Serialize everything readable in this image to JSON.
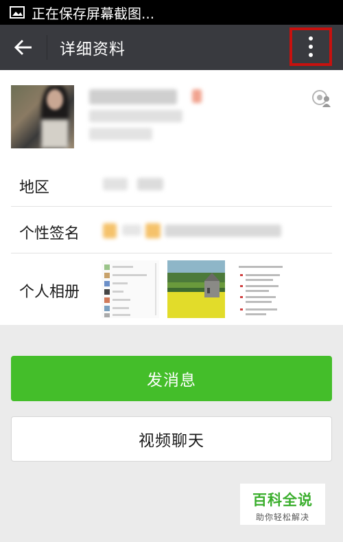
{
  "status_bar": {
    "text": "正在保存屏幕截图..."
  },
  "header": {
    "title": "详细资料"
  },
  "rows": {
    "region_label": "地区",
    "signature_label": "个性签名",
    "album_label": "个人相册"
  },
  "actions": {
    "send_message": "发消息",
    "video_chat": "视频聊天"
  },
  "watermark": {
    "title": "百科全说",
    "subtitle": "助你轻松解决"
  },
  "colors": {
    "header_bg": "#393a3f",
    "accent_green": "#44be2a",
    "highlight_red": "#c8110e"
  }
}
